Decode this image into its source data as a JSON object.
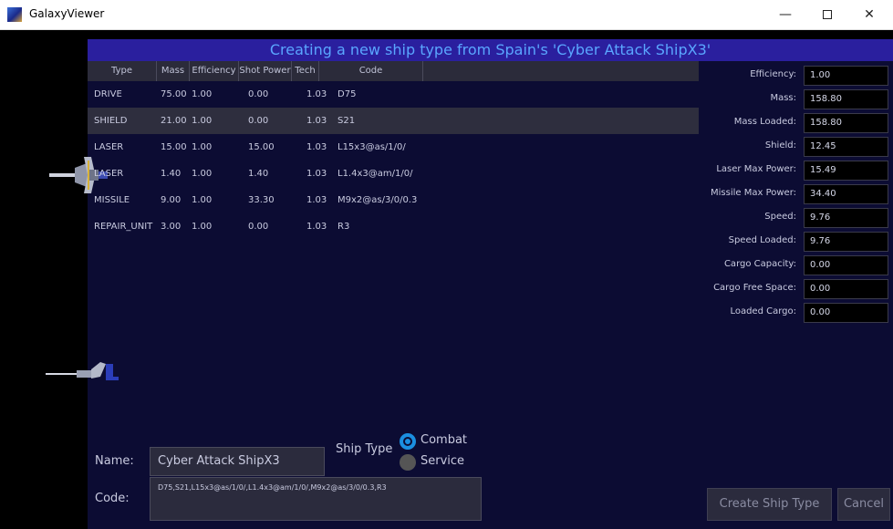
{
  "window": {
    "title": "GalaxyViewer",
    "minimize_glyph": "—",
    "close_glyph": "✕"
  },
  "header": {
    "title": "Creating a new ship type from Spain's 'Cyber Attack ShipX3'"
  },
  "table": {
    "columns": [
      "Type",
      "Mass",
      "Efficiency",
      "Shot Power",
      "Tech",
      "Code"
    ],
    "rows": [
      {
        "type": "DRIVE",
        "mass": "75.00",
        "efficiency": "1.00",
        "shot_power": "0.00",
        "tech": "1.03",
        "code": "D75"
      },
      {
        "type": "SHIELD",
        "mass": "21.00",
        "efficiency": "1.00",
        "shot_power": "0.00",
        "tech": "1.03",
        "code": "S21"
      },
      {
        "type": "LASER",
        "mass": "15.00",
        "efficiency": "1.00",
        "shot_power": "15.00",
        "tech": "1.03",
        "code": "L15x3@as/1/0/"
      },
      {
        "type": "LASER",
        "mass": "1.40",
        "efficiency": "1.00",
        "shot_power": "1.40",
        "tech": "1.03",
        "code": "L1.4x3@am/1/0/"
      },
      {
        "type": "MISSILE",
        "mass": "9.00",
        "efficiency": "1.00",
        "shot_power": "33.30",
        "tech": "1.03",
        "code": "M9x2@as/3/0/0.3"
      },
      {
        "type": "REPAIR_UNIT",
        "mass": "3.00",
        "efficiency": "1.00",
        "shot_power": "0.00",
        "tech": "1.03",
        "code": "R3"
      }
    ]
  },
  "stats": [
    {
      "label": "Efficiency:",
      "value": "1.00"
    },
    {
      "label": "Mass:",
      "value": "158.80"
    },
    {
      "label": "Mass Loaded:",
      "value": "158.80"
    },
    {
      "label": "Shield:",
      "value": "12.45"
    },
    {
      "label": "Laser Max Power:",
      "value": "15.49"
    },
    {
      "label": "Missile Max Power:",
      "value": "34.40"
    },
    {
      "label": "Speed:",
      "value": "9.76"
    },
    {
      "label": "Speed Loaded:",
      "value": "9.76"
    },
    {
      "label": "Cargo Capacity:",
      "value": "0.00"
    },
    {
      "label": "Cargo Free Space:",
      "value": "0.00"
    },
    {
      "label": "Loaded Cargo:",
      "value": "0.00"
    }
  ],
  "form": {
    "name_label": "Name:",
    "name_value": "Cyber Attack ShipX3",
    "code_label": "Code:",
    "code_value": "D75,S21,L15x3@as/1/0/,L1.4x3@am/1/0/,M9x2@as/3/0/0.3,R3",
    "ship_type_label": "Ship Type",
    "options": [
      {
        "label": "Combat",
        "selected": true
      },
      {
        "label": "Service",
        "selected": false
      }
    ]
  },
  "buttons": {
    "create": "Create Ship Type",
    "cancel": "Cancel"
  },
  "colors": {
    "panel": "#0c0c33",
    "header": "#2a1f9e",
    "header_text": "#5aa6ff",
    "accent": "#1b8fe0"
  }
}
